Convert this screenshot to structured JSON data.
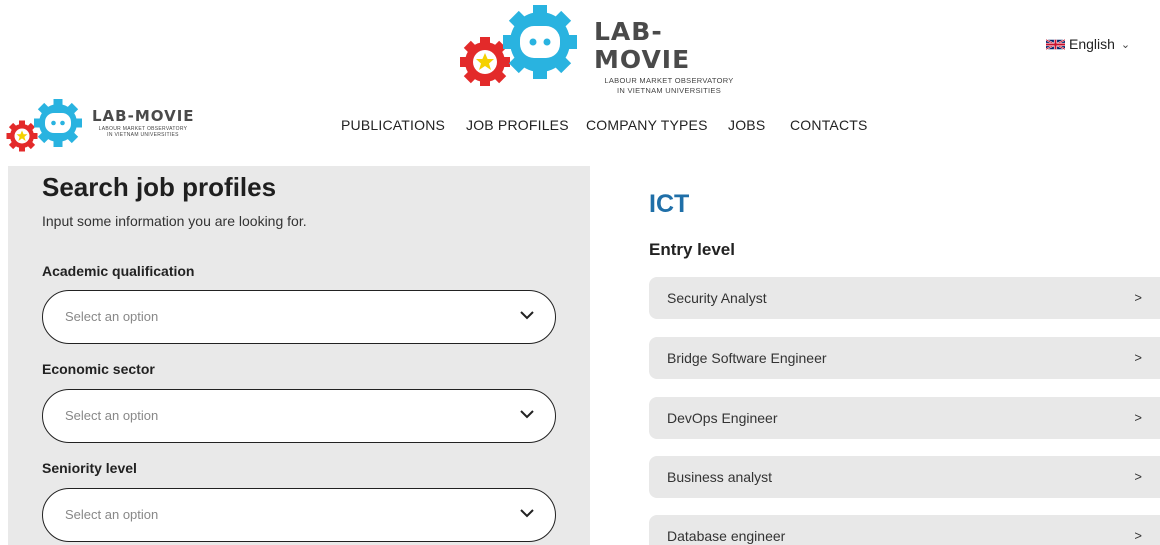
{
  "header": {
    "brand_title": "LAB-MOVIE",
    "brand_sub_line1": "LABOUR MARKET OBSERVATORY",
    "brand_sub_line2": "IN VIETNAM UNIVERSITIES",
    "language": "English",
    "language_flag": "uk-flag-icon",
    "brand_colors": {
      "gear_blue": "#29b3e0",
      "gear_red": "#e32a2a",
      "star": "#f5d100",
      "text": "#4a4a4a"
    }
  },
  "nav": {
    "items": [
      "PUBLICATIONS",
      "JOB PROFILES",
      "COMPANY TYPES",
      "JOBS",
      "CONTACTS"
    ]
  },
  "search": {
    "title": "Search job profiles",
    "intro": "Input some information you are looking for.",
    "fields": [
      {
        "label": "Academic qualification",
        "placeholder": "Select an option"
      },
      {
        "label": "Economic sector",
        "placeholder": "Select an option"
      },
      {
        "label": "Seniority level",
        "placeholder": "Select an option"
      }
    ]
  },
  "results": {
    "category": "ICT",
    "level": "Entry level",
    "jobs": [
      "Security Analyst",
      "Bridge Software Engineer",
      "DevOps Engineer",
      "Business analyst",
      "Database engineer"
    ],
    "accent": "#1f6fa8"
  }
}
